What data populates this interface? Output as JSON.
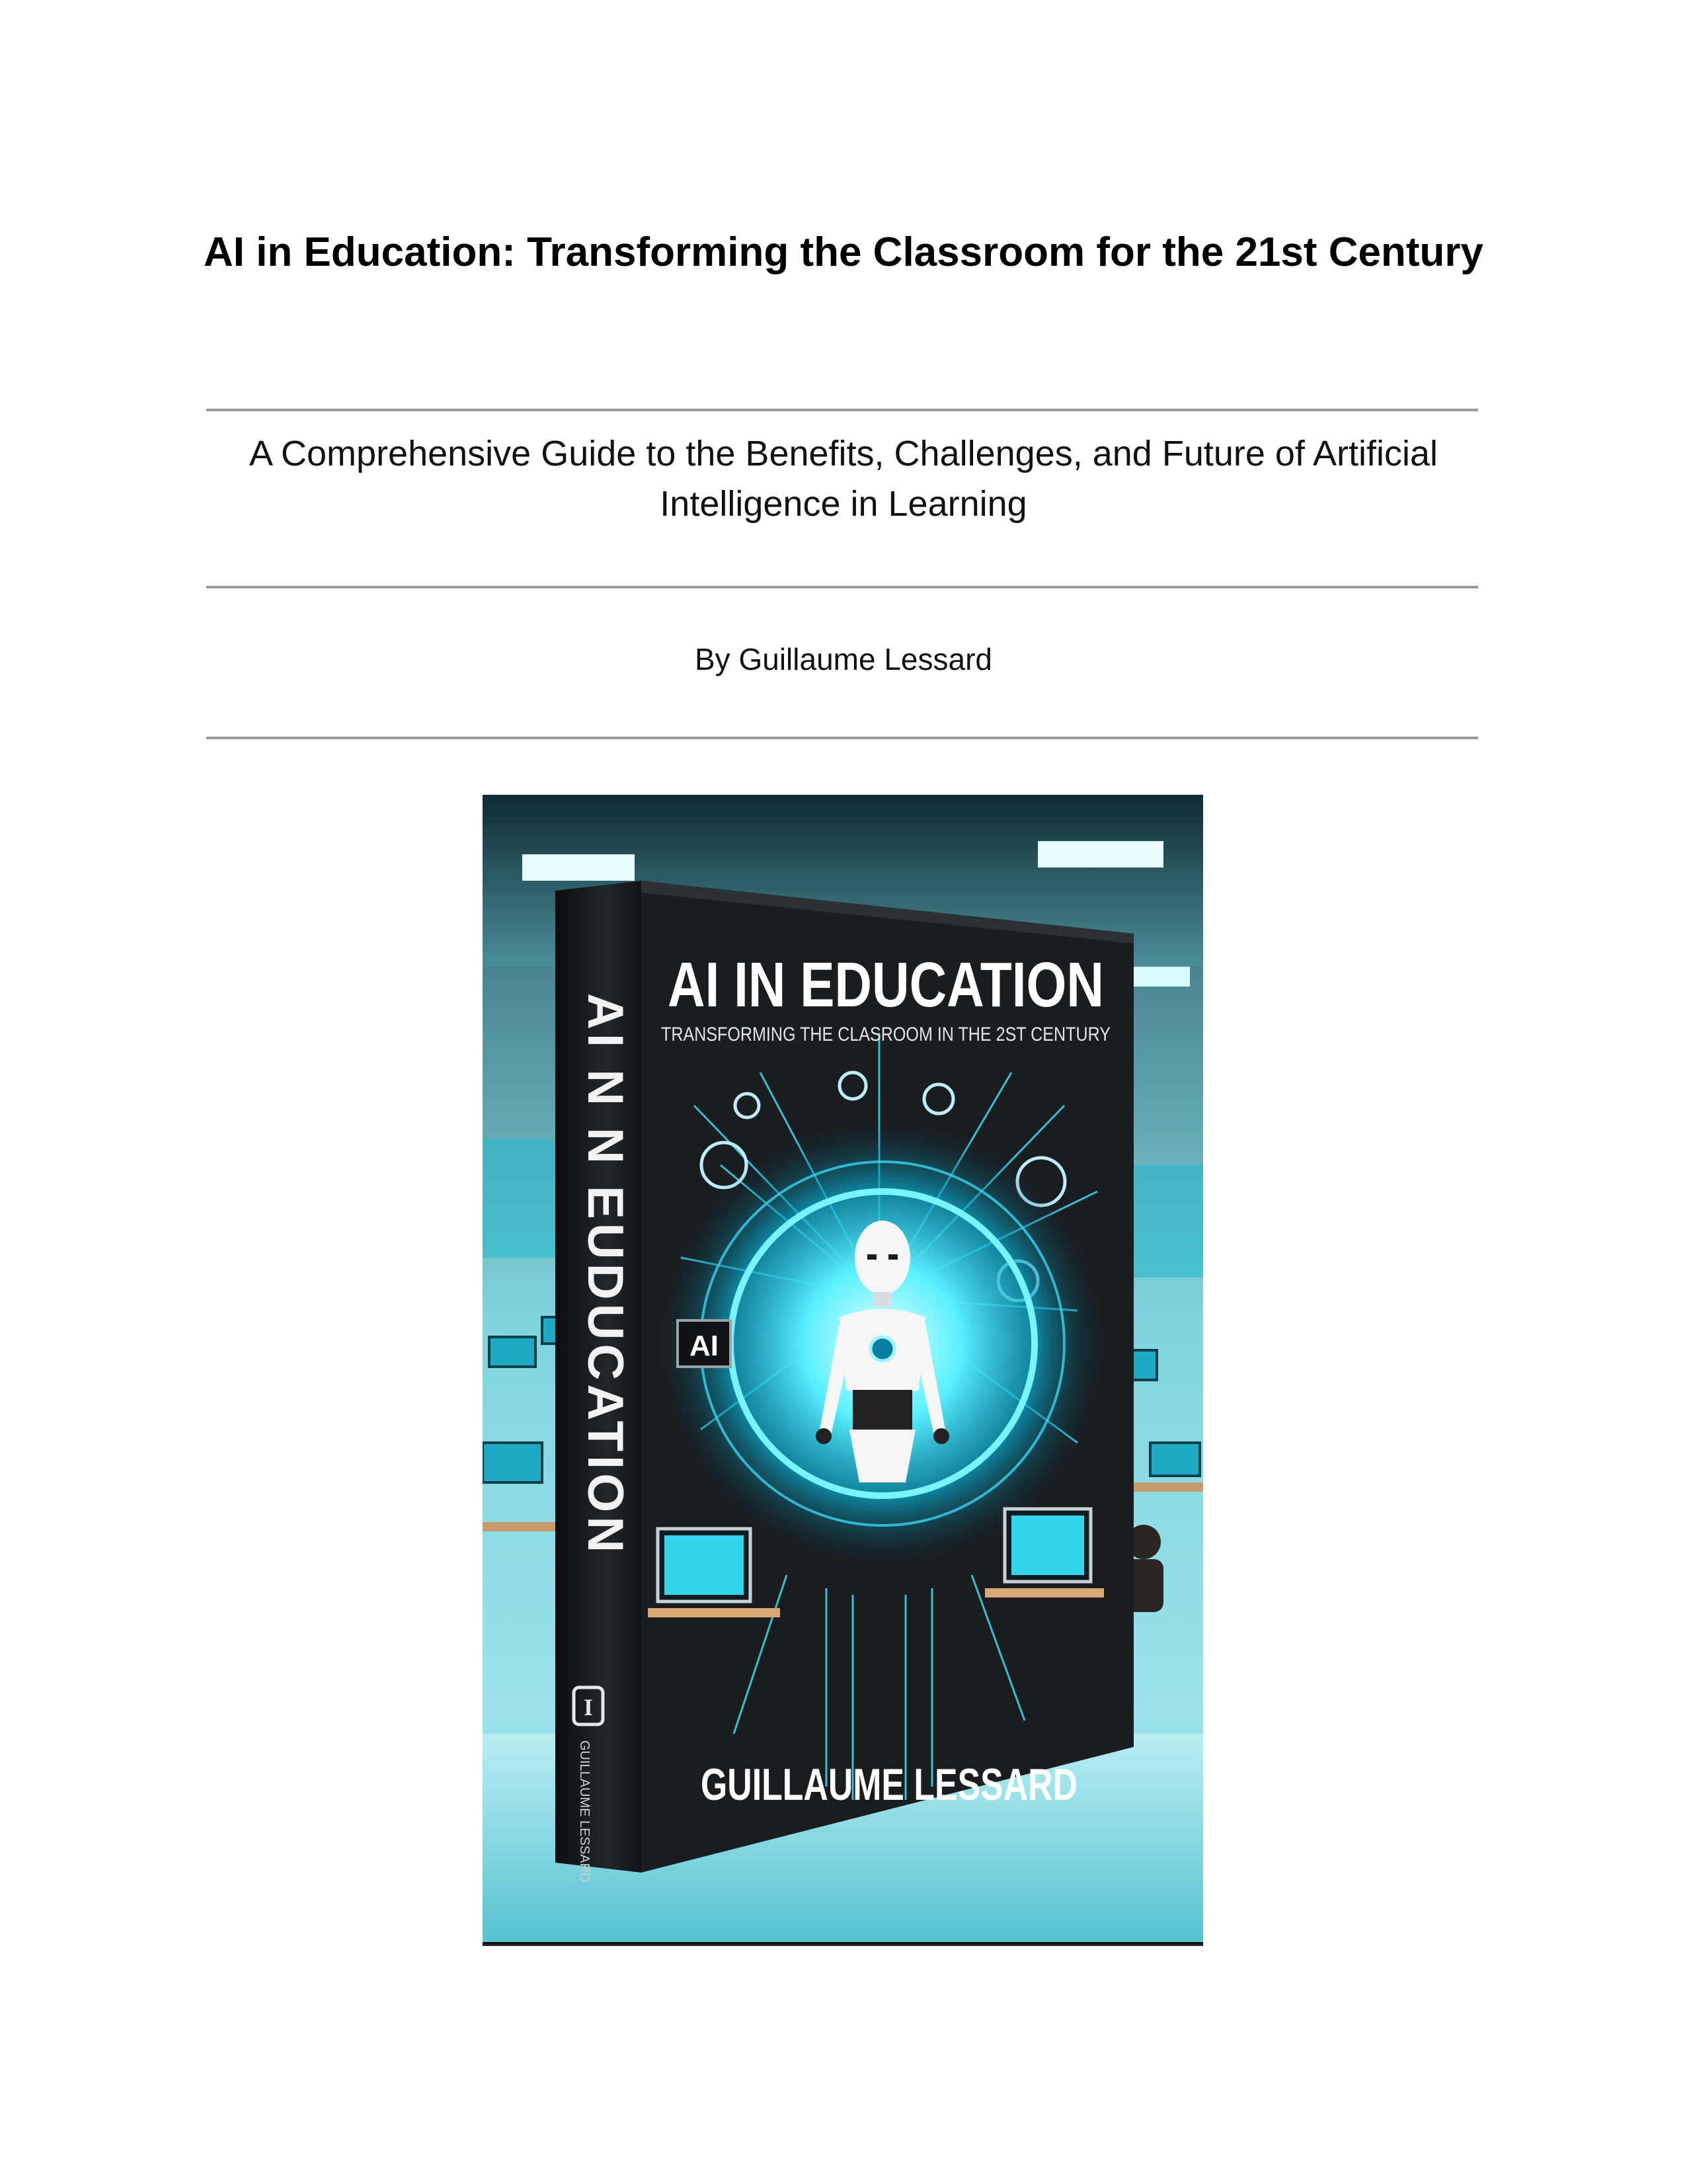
{
  "document": {
    "title": "AI in Education: Transforming the Classroom for the 21st Century",
    "subtitle": "A Comprehensive Guide to the Benefits, Challenges, and Future of Artificial Intelligence in Learning",
    "author_line": "By Guillaume Lessard"
  },
  "cover_image": {
    "spine_title": "AI N N EUDUCATION",
    "front_title": "AI IN EDUCATION",
    "front_tagline": "TRANSFORMING THE CLASROOM IN THE 2ST CENTURY",
    "ai_badge": "AI",
    "author_name": "GUILLAUME LESSARD",
    "spine_publisher": "GUILLAUME LESSARD",
    "colors": {
      "glow": "#3fe6ff",
      "book": "#1a1d20",
      "room": "#7fd3dc",
      "floor": "#8fdde6"
    }
  }
}
